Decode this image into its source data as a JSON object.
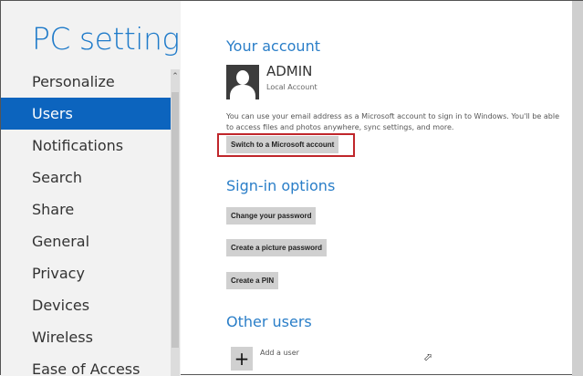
{
  "sidebar": {
    "title": "PC settings",
    "items": [
      {
        "label": "Personalize"
      },
      {
        "label": "Users",
        "selected": true
      },
      {
        "label": "Notifications"
      },
      {
        "label": "Search"
      },
      {
        "label": "Share"
      },
      {
        "label": "General"
      },
      {
        "label": "Privacy"
      },
      {
        "label": "Devices"
      },
      {
        "label": "Wireless"
      },
      {
        "label": "Ease of Access"
      }
    ]
  },
  "account": {
    "heading": "Your account",
    "name": "ADMIN",
    "type": "Local Account",
    "description": "You can use your email address as a Microsoft account to sign in to Windows. You'll be able to access files and photos anywhere, sync settings, and more.",
    "switch_label": "Switch to a Microsoft account"
  },
  "signin": {
    "heading": "Sign-in options",
    "change_password": "Change your password",
    "picture_password": "Create a picture password",
    "pin": "Create a PIN"
  },
  "others": {
    "heading": "Other users",
    "add_label": "Add a user",
    "add_icon": "+"
  },
  "colors": {
    "accent": "#0c64be",
    "highlight": "#c0262b"
  }
}
